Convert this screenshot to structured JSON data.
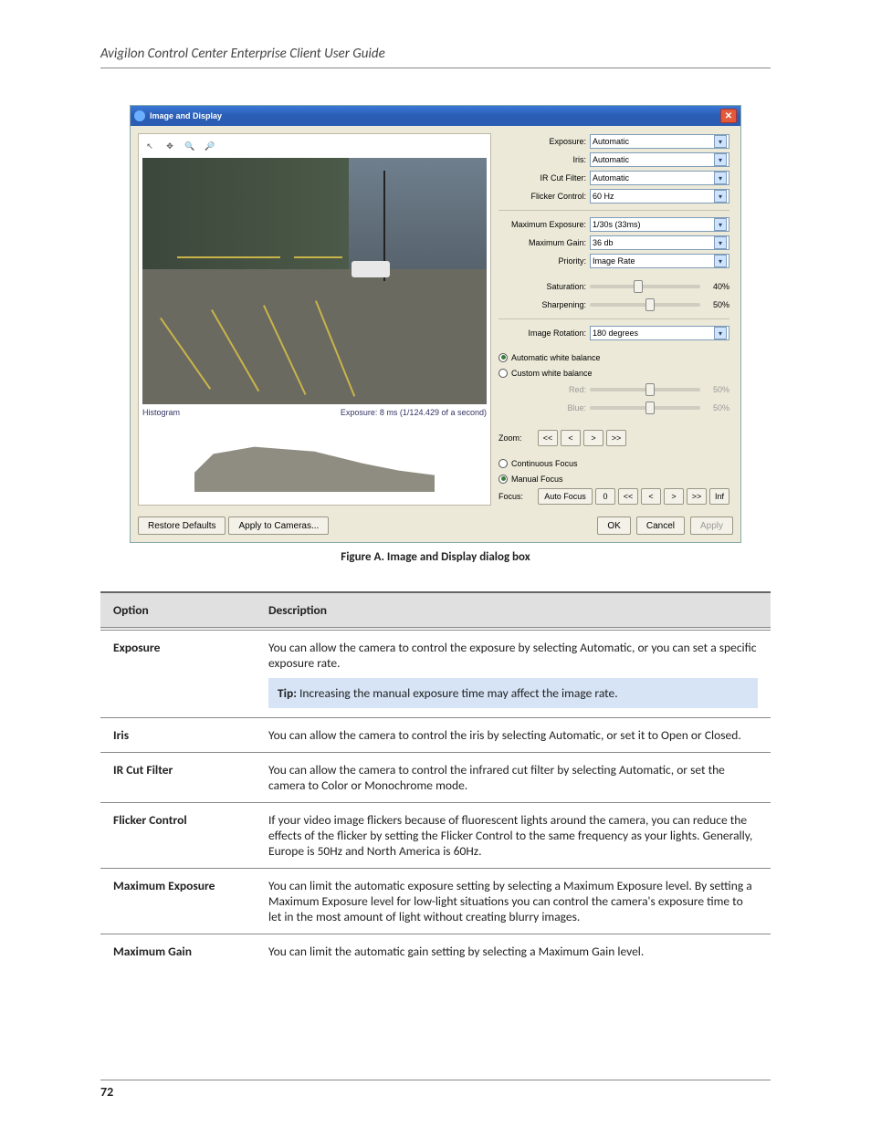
{
  "page": {
    "header": "Avigilon Control Center Enterprise Client User Guide",
    "figure_caption": "Figure A. Image and Display dialog box",
    "page_number": "72"
  },
  "dialog": {
    "title": "Image and Display",
    "histogram_label": "Histogram",
    "exposure_readout": "Exposure: 8 ms (1/124.429 of a second)",
    "fields": {
      "exposure": {
        "label": "Exposure:",
        "value": "Automatic"
      },
      "iris": {
        "label": "Iris:",
        "value": "Automatic"
      },
      "ir_cut": {
        "label": "IR Cut Filter:",
        "value": "Automatic"
      },
      "flicker": {
        "label": "Flicker Control:",
        "value": "60 Hz"
      },
      "max_exposure": {
        "label": "Maximum Exposure:",
        "value": "1/30s (33ms)"
      },
      "max_gain": {
        "label": "Maximum Gain:",
        "value": "36 db"
      },
      "priority": {
        "label": "Priority:",
        "value": "Image Rate"
      },
      "image_rotation": {
        "label": "Image Rotation:",
        "value": "180 degrees"
      }
    },
    "sliders": {
      "saturation": {
        "label": "Saturation:",
        "value": "40%",
        "pos": 40
      },
      "sharpening": {
        "label": "Sharpening:",
        "value": "50%",
        "pos": 50
      },
      "red": {
        "label": "Red:",
        "value": "50%",
        "pos": 50
      },
      "blue": {
        "label": "Blue:",
        "value": "50%",
        "pos": 50
      }
    },
    "wb": {
      "auto": "Automatic white balance",
      "custom": "Custom white balance"
    },
    "zoom": {
      "label": "Zoom:",
      "btn_out_fast": "<<",
      "btn_out": "<",
      "btn_in": ">",
      "btn_in_fast": ">>"
    },
    "focus": {
      "continuous": "Continuous Focus",
      "manual": "Manual Focus",
      "label": "Focus:",
      "auto_btn": "Auto Focus",
      "near_limit": "0",
      "near_fast": "<<",
      "near": "<",
      "far": ">",
      "far_fast": ">>",
      "inf": "Inf"
    },
    "bottom": {
      "restore": "Restore Defaults",
      "apply_cams": "Apply to Cameras...",
      "ok": "OK",
      "cancel": "Cancel",
      "apply": "Apply"
    }
  },
  "table": {
    "head_opt": "Option",
    "head_desc": "Description",
    "rows": [
      {
        "opt": "Exposure",
        "desc": "You can allow the camera to control the exposure by selecting Automatic, or you can set a specific exposure rate.",
        "tip": "Increasing the manual exposure time may affect the image rate."
      },
      {
        "opt": "Iris",
        "desc": "You can allow the camera to control the iris by selecting Automatic, or set it to Open or Closed."
      },
      {
        "opt": "IR Cut Filter",
        "desc": "You can allow the camera to control the infrared cut filter by selecting Automatic, or set the camera to Color or Monochrome mode."
      },
      {
        "opt": "Flicker Control",
        "desc": "If your video image flickers because of fluorescent lights around the camera, you can reduce the effects of the flicker by setting the Flicker Control to the same frequency as your lights. Generally, Europe is 50Hz and North America is 60Hz."
      },
      {
        "opt": "Maximum Exposure",
        "desc": "You can limit the automatic exposure setting by selecting a Maximum Exposure level. By setting a Maximum Exposure level for low-light situations you can control the camera's exposure time to let in the most amount of light without creating blurry images."
      },
      {
        "opt": "Maximum Gain",
        "desc": "You can limit the automatic gain setting by selecting a Maximum Gain level."
      }
    ],
    "tip_label": "Tip:"
  }
}
